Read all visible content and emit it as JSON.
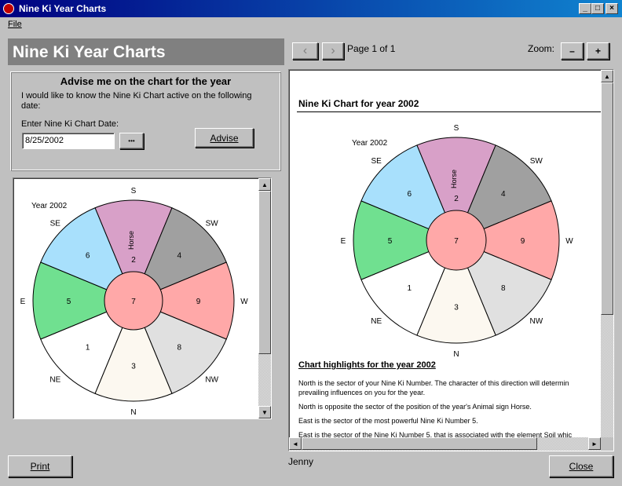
{
  "window": {
    "title": "Nine Ki Year Charts"
  },
  "menu": {
    "file": "File"
  },
  "banner": {
    "title": "Nine Ki Year Charts"
  },
  "advise": {
    "heading": "Advise me on the chart for the year",
    "description": "I would like to know the Nine Ki Chart active on the following date:",
    "date_label": "Enter Nine Ki Chart Date:",
    "date_value": "8/25/2002",
    "browse_label": "•••",
    "advise_button": "Advise"
  },
  "preview_toolbar": {
    "prev_icon": "‹",
    "next_icon": "›",
    "page_label": "Page 1 of 1",
    "zoom_label": "Zoom:",
    "zoom_out": "–",
    "zoom_in": "+"
  },
  "report": {
    "title": "Nine Ki Chart for year 2002",
    "highlights_heading": "Chart highlights for the year 2002",
    "paragraphs": [
      "North is the sector of your Nine Ki Number.  The character of this direction will determin",
      "prevailing influences on you for the year.",
      "North is opposite the sector of the position of the year's Animal sign Horse.",
      "East is the sector of the most powerful Nine Ki Number 5.",
      "East is the sector of the Nine Ki Number 5, that is associated with the element Soil whic"
    ]
  },
  "chart": {
    "year_label": "Year 2002",
    "center_number": "7",
    "animal_sign": "Horse",
    "sectors": [
      {
        "direction": "S",
        "number": "2",
        "color": "#d8a0c8"
      },
      {
        "direction": "SW",
        "number": "4",
        "color": "#a0a0a0"
      },
      {
        "direction": "W",
        "number": "9",
        "color": "#ffa8a8"
      },
      {
        "direction": "NW",
        "number": "8",
        "color": "#e0e0e0"
      },
      {
        "direction": "N",
        "number": "3",
        "color": "#fcf8f0"
      },
      {
        "direction": "NE",
        "number": "1",
        "color": "#ffffff"
      },
      {
        "direction": "E",
        "number": "5",
        "color": "#70e090"
      },
      {
        "direction": "SE",
        "number": "6",
        "color": "#a8e0fc"
      }
    ],
    "center_color": "#ffa8a8"
  },
  "footer": {
    "print_button": "Print",
    "user": "Jenny",
    "close_button": "Close"
  }
}
